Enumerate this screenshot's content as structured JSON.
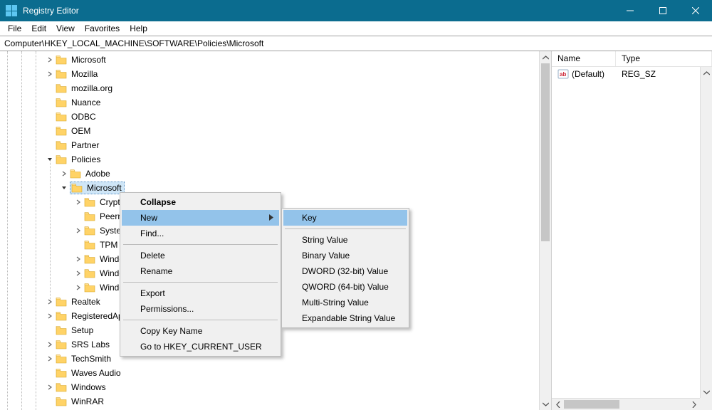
{
  "window": {
    "title": "Registry Editor"
  },
  "menubar": [
    "File",
    "Edit",
    "View",
    "Favorites",
    "Help"
  ],
  "address": "Computer\\HKEY_LOCAL_MACHINE\\SOFTWARE\\Policies\\Microsoft",
  "tree": [
    {
      "indent": 3,
      "chev": "right",
      "label": "Microsoft"
    },
    {
      "indent": 3,
      "chev": "right",
      "label": "Mozilla"
    },
    {
      "indent": 3,
      "chev": "none",
      "label": "mozilla.org"
    },
    {
      "indent": 3,
      "chev": "none",
      "label": "Nuance"
    },
    {
      "indent": 3,
      "chev": "none",
      "label": "ODBC"
    },
    {
      "indent": 3,
      "chev": "none",
      "label": "OEM"
    },
    {
      "indent": 3,
      "chev": "none",
      "label": "Partner"
    },
    {
      "indent": 3,
      "chev": "down",
      "label": "Policies"
    },
    {
      "indent": 4,
      "chev": "right",
      "label": "Adobe"
    },
    {
      "indent": 4,
      "chev": "down",
      "label": "Microsoft",
      "selected": true
    },
    {
      "indent": 5,
      "chev": "right",
      "label": "Cryptography"
    },
    {
      "indent": 5,
      "chev": "none",
      "label": "Peernet"
    },
    {
      "indent": 5,
      "chev": "right",
      "label": "SystemCertificates"
    },
    {
      "indent": 5,
      "chev": "none",
      "label": "TPM"
    },
    {
      "indent": 5,
      "chev": "right",
      "label": "Windows"
    },
    {
      "indent": 5,
      "chev": "right",
      "label": "Windows Defender"
    },
    {
      "indent": 5,
      "chev": "right",
      "label": "Windows NT"
    },
    {
      "indent": 3,
      "chev": "right",
      "label": "Realtek"
    },
    {
      "indent": 3,
      "chev": "right",
      "label": "RegisteredApplications"
    },
    {
      "indent": 3,
      "chev": "none",
      "label": "Setup"
    },
    {
      "indent": 3,
      "chev": "right",
      "label": "SRS Labs"
    },
    {
      "indent": 3,
      "chev": "right",
      "label": "TechSmith"
    },
    {
      "indent": 3,
      "chev": "none",
      "label": "Waves Audio"
    },
    {
      "indent": 3,
      "chev": "right",
      "label": "Windows"
    },
    {
      "indent": 3,
      "chev": "none",
      "label": "WinRAR"
    }
  ],
  "values": {
    "headers": {
      "name": "Name",
      "type": "Type"
    },
    "rows": [
      {
        "name": "(Default)",
        "type": "REG_SZ"
      }
    ]
  },
  "context_menu": {
    "items": [
      {
        "label": "Collapse",
        "bold": true
      },
      {
        "label": "New",
        "submenu": true,
        "highlight": true
      },
      {
        "label": "Find..."
      },
      {
        "sep": true
      },
      {
        "label": "Delete"
      },
      {
        "label": "Rename"
      },
      {
        "sep": true
      },
      {
        "label": "Export"
      },
      {
        "label": "Permissions..."
      },
      {
        "sep": true
      },
      {
        "label": "Copy Key Name"
      },
      {
        "label": "Go to HKEY_CURRENT_USER"
      }
    ]
  },
  "submenu": {
    "items": [
      {
        "label": "Key",
        "highlight": true
      },
      {
        "sep": true
      },
      {
        "label": "String Value"
      },
      {
        "label": "Binary Value"
      },
      {
        "label": "DWORD (32-bit) Value"
      },
      {
        "label": "QWORD (64-bit) Value"
      },
      {
        "label": "Multi-String Value"
      },
      {
        "label": "Expandable String Value"
      }
    ]
  }
}
